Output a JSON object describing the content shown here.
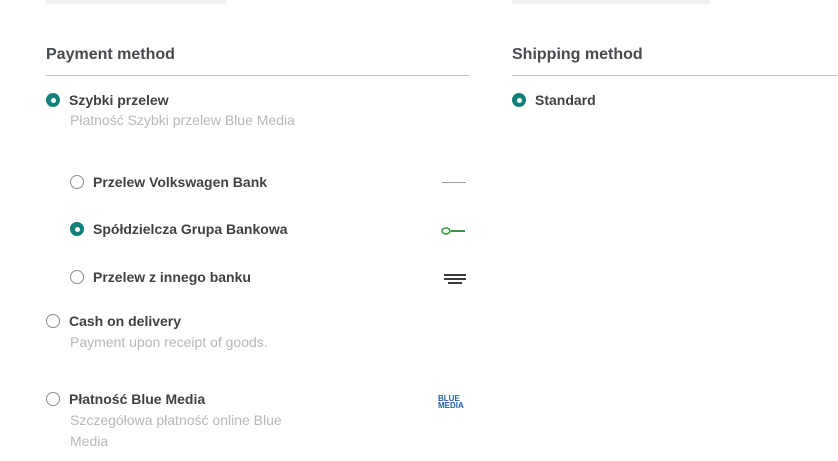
{
  "payment": {
    "title": "Payment method",
    "options": [
      {
        "label": "Szybki przelew",
        "description": "Płatność Szybki przelew Blue Media",
        "checked": true
      },
      {
        "label": "Cash on delivery",
        "description": "Payment upon receipt of goods.",
        "checked": false
      },
      {
        "label": "Płatność Blue Media",
        "description": "Szczegółowa płatność online Blue Media",
        "logo": "blue-media-logo",
        "checked": false
      }
    ],
    "banks": [
      {
        "label": "Przelew Volkswagen Bank",
        "logo": "volkswagen-bank-logo",
        "checked": false
      },
      {
        "label": "Spółdzielcza Grupa Bankowa",
        "logo": "sgb-bank-logo",
        "checked": true
      },
      {
        "label": "Przelew z innego banku",
        "logo": "other-bank-logo",
        "checked": false
      }
    ]
  },
  "logos": {
    "blue_media": "BLUE MEDIA"
  },
  "shipping": {
    "title": "Shipping method",
    "options": [
      {
        "label": "Standard",
        "checked": true
      }
    ]
  },
  "colors": {
    "accent": "#137f7a",
    "muted_text": "#b6b8bb",
    "title_text": "#474a4e"
  }
}
